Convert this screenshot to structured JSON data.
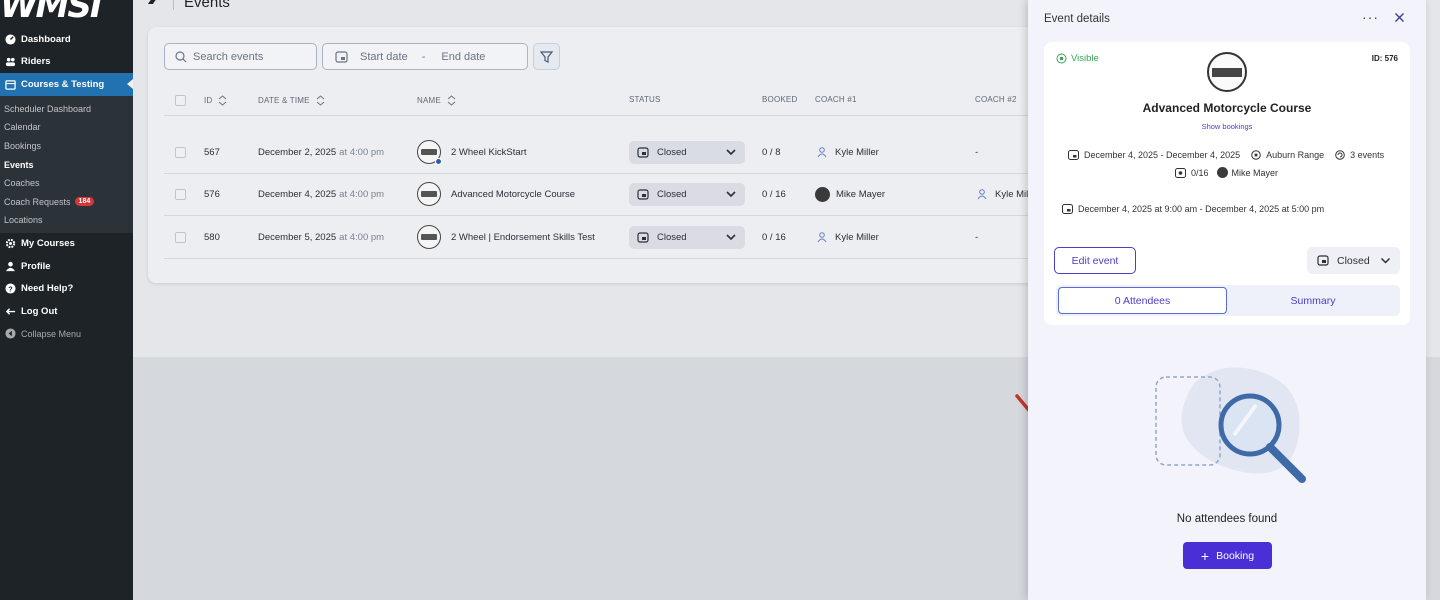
{
  "brand": {
    "logo_text": "WMSI"
  },
  "sidebar": {
    "items_top": [
      {
        "label": "Dashboard",
        "icon": "dashboard-icon"
      },
      {
        "label": "Riders",
        "icon": "users-icon"
      },
      {
        "label": "Courses & Testing",
        "icon": "calendar-icon"
      }
    ],
    "submenu": [
      {
        "label": "Scheduler Dashboard"
      },
      {
        "label": "Calendar"
      },
      {
        "label": "Bookings"
      },
      {
        "label": "Events"
      },
      {
        "label": "Coaches"
      },
      {
        "label": "Coach Requests",
        "badge": "184"
      },
      {
        "label": "Locations"
      }
    ],
    "items_bottom": [
      {
        "label": "My Courses",
        "icon": "gear-icon"
      },
      {
        "label": "Profile",
        "icon": "user-icon"
      },
      {
        "label": "Need Help?",
        "icon": "help-icon"
      },
      {
        "label": "Log Out",
        "icon": "logout-icon"
      },
      {
        "label": "Collapse Menu",
        "icon": "collapse-icon"
      }
    ]
  },
  "header": {
    "title": "Events"
  },
  "toolbar": {
    "search_placeholder": "Search events",
    "start_date_placeholder": "Start date",
    "date_separator": "-",
    "end_date_placeholder": "End date"
  },
  "table": {
    "columns": [
      "ID",
      "DATE & TIME",
      "NAME",
      "STATUS",
      "BOOKED",
      "COACH #1",
      "COACH #2"
    ],
    "rows": [
      {
        "id": "567",
        "date": "December 2, 2025",
        "time": "at 4:00 pm",
        "name": "2 Wheel KickStart",
        "status": "Closed",
        "booked": "0 / 8",
        "coach1": "Kyle Miller",
        "coach2": "-"
      },
      {
        "id": "576",
        "date": "December 4, 2025",
        "time": "at 4:00 pm",
        "name": "Advanced Motorcycle Course",
        "status": "Closed",
        "booked": "0 / 16",
        "coach1": "Mike Mayer",
        "coach2": "Kyle Mil"
      },
      {
        "id": "580",
        "date": "December 5, 2025",
        "time": "at 4:00 pm",
        "name": "2 Wheel | Endorsement Skills Test",
        "status": "Closed",
        "booked": "0 / 16",
        "coach1": "Kyle Miller",
        "coach2": "-"
      }
    ]
  },
  "panel": {
    "title": "Event details",
    "more_label": "···",
    "visibility": "Visible",
    "id_label": "ID: 576",
    "event_name": "Advanced Motorcycle Course",
    "show_bookings": "Show bookings",
    "date_range": "December 4, 2025 - December 4, 2025",
    "location": "Auburn Range",
    "events_count": "3 events",
    "capacity": "0/16",
    "coach": "Mike Mayer",
    "datetime_range": "December 4, 2025 at 9:00 am - December 4, 2025 at 5:00 pm",
    "edit_label": "Edit event",
    "status": "Closed",
    "tabs": [
      "0 Attendees",
      "Summary"
    ],
    "empty_text": "No attendees found",
    "booking_label": "Booking",
    "booking_plus": "+"
  },
  "colors": {
    "accent": "#4b2fd6",
    "sidebar": "#1d2327",
    "active": "#2271b1",
    "annotation_arrow": "#c0392b"
  }
}
